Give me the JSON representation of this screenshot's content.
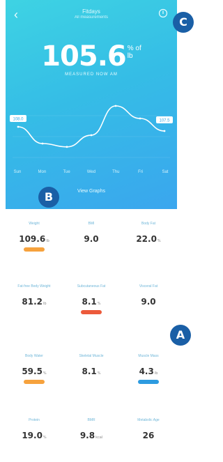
{
  "header": {
    "back_icon": "back-chevron-icon",
    "profile_name": "Fitdays",
    "profile_sub": "All measurements",
    "share_icon": "share-icon"
  },
  "weight": {
    "value": "105.6",
    "unit_top": "% of",
    "unit_bottom": "lb",
    "time": "MEASURED NOW AM"
  },
  "chart_data": {
    "type": "line",
    "x": [
      "Sun",
      "Mon",
      "Tue",
      "Wed",
      "Thu",
      "Fri",
      "Sat"
    ],
    "values": [
      108.0,
      106.0,
      105.6,
      107.0,
      110.5,
      109.0,
      107.5
    ],
    "start_label": "108.0",
    "end_label": "107.5",
    "ylabel": "",
    "xlabel": ""
  },
  "view_graphs": "View Graphs",
  "metrics": [
    {
      "label": "Weight",
      "value": "109.6",
      "unit": "lb",
      "badge": "#f6a23d"
    },
    {
      "label": "BMI",
      "value": "9.0",
      "unit": "",
      "badge": ""
    },
    {
      "label": "Body Fat",
      "value": "22.0",
      "unit": "%",
      "badge": ""
    },
    {
      "label": "Fat-free Body Weight",
      "value": "81.2",
      "unit": "lb",
      "badge": ""
    },
    {
      "label": "Subcutaneous Fat",
      "value": "8.1",
      "unit": "%",
      "badge": "#ec5a3b"
    },
    {
      "label": "Visceral Fat",
      "value": "9.0",
      "unit": "",
      "badge": ""
    },
    {
      "label": "Body Water",
      "value": "59.5",
      "unit": "%",
      "badge": "#f6a23d"
    },
    {
      "label": "Skeletal Muscle",
      "value": "8.1",
      "unit": "%",
      "badge": ""
    },
    {
      "label": "Muscle Mass",
      "value": "4.3",
      "unit": "lb",
      "badge": "#2d9be0"
    },
    {
      "label": "Protein",
      "value": "19.0",
      "unit": "%",
      "badge": ""
    },
    {
      "label": "BMR",
      "value": "9.8",
      "unit": "kcal",
      "badge": ""
    },
    {
      "label": "Metabolic Age",
      "value": "26",
      "unit": "",
      "badge": ""
    }
  ],
  "markers": {
    "a": "A",
    "b": "B",
    "c": "C"
  }
}
